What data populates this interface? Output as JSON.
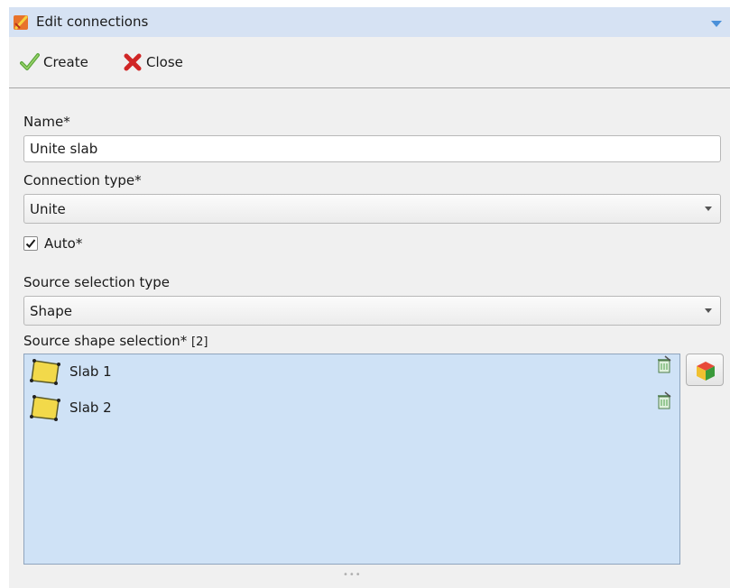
{
  "panel": {
    "title": "Edit connections"
  },
  "toolbar": {
    "create_label": "Create",
    "close_label": "Close"
  },
  "form": {
    "name_label": "Name*",
    "name_value": "Unite slab",
    "connection_type_label": "Connection type*",
    "connection_type_value": "Unite",
    "auto_label": "Auto*",
    "auto_checked": true,
    "source_selection_type_label": "Source selection type",
    "source_selection_type_value": "Shape",
    "source_shape_selection_label": "Source shape selection*",
    "source_shape_selection_count": "[2]"
  },
  "source_shapes": [
    {
      "name": "Slab 1",
      "icon": "slab-icon"
    },
    {
      "name": "Slab 2",
      "icon": "slab-icon"
    }
  ],
  "colors": {
    "title_bar": "#d6e2f3",
    "list_background": "#cfe2f6",
    "panel_background": "#f0f0f0"
  }
}
